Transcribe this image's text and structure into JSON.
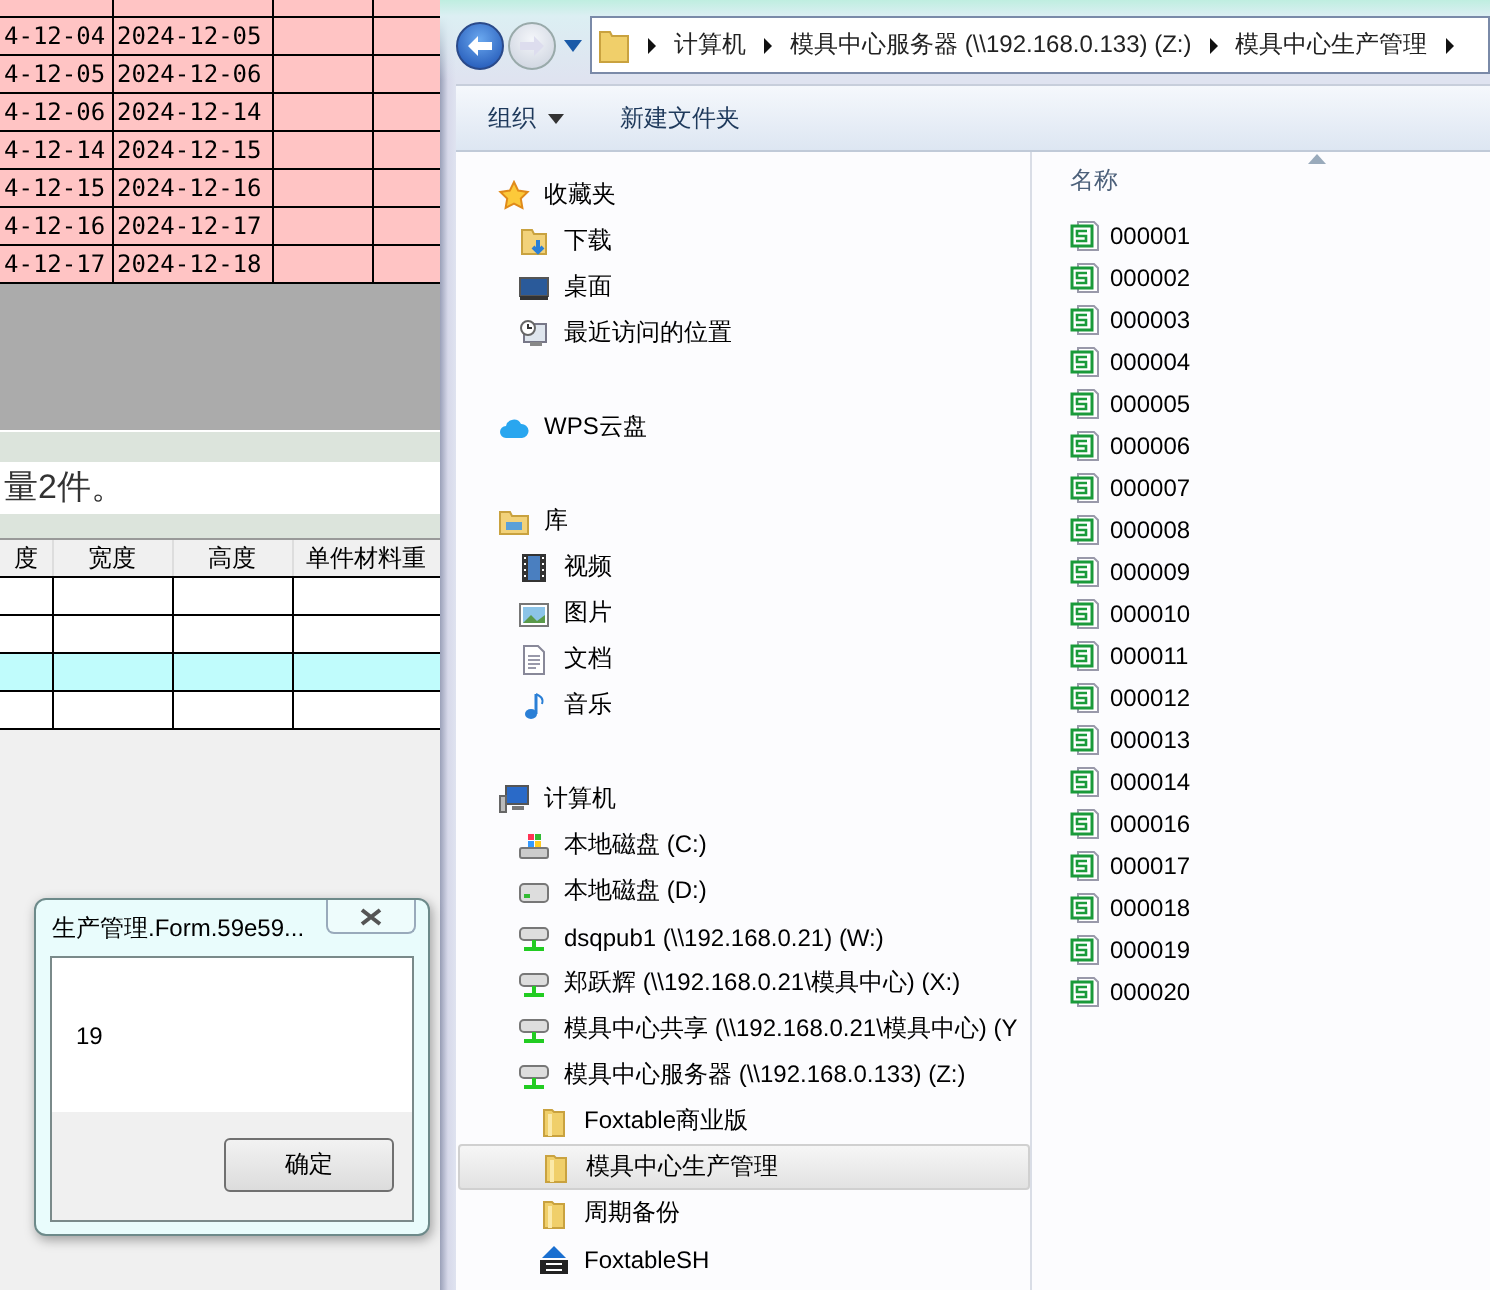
{
  "background_app": {
    "top_table": {
      "rows": [
        {
          "cells": [
            "4-12-04",
            "2024-12-05"
          ]
        },
        {
          "cells": [
            "4-12-05",
            "2024-12-06"
          ]
        },
        {
          "cells": [
            "4-12-06",
            "2024-12-14"
          ]
        },
        {
          "cells": [
            "4-12-14",
            "2024-12-15"
          ]
        },
        {
          "cells": [
            "4-12-15",
            "2024-12-16"
          ]
        },
        {
          "cells": [
            "4-12-16",
            "2024-12-17"
          ]
        },
        {
          "cells": [
            "4-12-17",
            "2024-12-18"
          ]
        }
      ]
    },
    "note": "量2件。",
    "bottom_table": {
      "columns": [
        "度",
        "宽度",
        "高度",
        "单件材料重"
      ],
      "rows": [
        {
          "selected": false
        },
        {
          "selected": false
        },
        {
          "selected": true
        },
        {
          "selected": false
        }
      ]
    }
  },
  "message_box": {
    "title": "生产管理.Form.59e59...",
    "message": "19",
    "buttons": [
      "确定"
    ]
  },
  "explorer": {
    "address": [
      "计算机",
      "模具中心服务器 (\\\\192.168.0.133) (Z:)",
      "模具中心生产管理"
    ],
    "toolbar": [
      {
        "label": "组织",
        "dropdown": true
      },
      {
        "label": "新建文件夹",
        "dropdown": false
      }
    ],
    "nav": [
      {
        "label": "收藏夹",
        "kind": "star",
        "selected": false,
        "children": [
          {
            "label": "下载",
            "kind": "download",
            "selected": false
          },
          {
            "label": "桌面",
            "kind": "desktop",
            "selected": false
          },
          {
            "label": "最近访问的位置",
            "kind": "recent",
            "selected": false
          }
        ]
      },
      {
        "label": "WPS云盘",
        "kind": "cloud",
        "selected": false
      },
      {
        "label": "库",
        "kind": "library",
        "selected": false,
        "children": [
          {
            "label": "视频",
            "kind": "video",
            "selected": false
          },
          {
            "label": "图片",
            "kind": "picture",
            "selected": false
          },
          {
            "label": "文档",
            "kind": "document",
            "selected": false
          },
          {
            "label": "音乐",
            "kind": "music",
            "selected": false
          }
        ]
      },
      {
        "label": "计算机",
        "kind": "computer",
        "selected": false,
        "children": [
          {
            "label": "本地磁盘 (C:)",
            "kind": "system-drive",
            "selected": false
          },
          {
            "label": "本地磁盘 (D:)",
            "kind": "drive",
            "selected": false
          },
          {
            "label": "dsqpub1 (\\\\192.168.0.21) (W:)",
            "kind": "network",
            "selected": false
          },
          {
            "label": "郑跃辉 (\\\\192.168.0.21\\模具中心) (X:)",
            "kind": "network",
            "selected": false
          },
          {
            "label": "模具中心共享 (\\\\192.168.0.21\\模具中心) (Y",
            "kind": "network",
            "selected": false
          },
          {
            "label": "模具中心服务器 (\\\\192.168.0.133) (Z:)",
            "kind": "network",
            "selected": false,
            "children": [
              {
                "label": "Foxtable商业版",
                "kind": "folder",
                "selected": false
              },
              {
                "label": "模具中心生产管理",
                "kind": "folder",
                "selected": true
              },
              {
                "label": "周期备份",
                "kind": "folder",
                "selected": false
              },
              {
                "label": "FoxtableSH",
                "kind": "zip",
                "selected": false
              }
            ]
          }
        ]
      }
    ],
    "column_header": "名称",
    "files": [
      "000001",
      "000002",
      "000003",
      "000004",
      "000005",
      "000006",
      "000007",
      "000008",
      "000009",
      "000010",
      "000011",
      "000012",
      "000013",
      "000014",
      "000016",
      "000017",
      "000018",
      "000019",
      "000020"
    ]
  }
}
